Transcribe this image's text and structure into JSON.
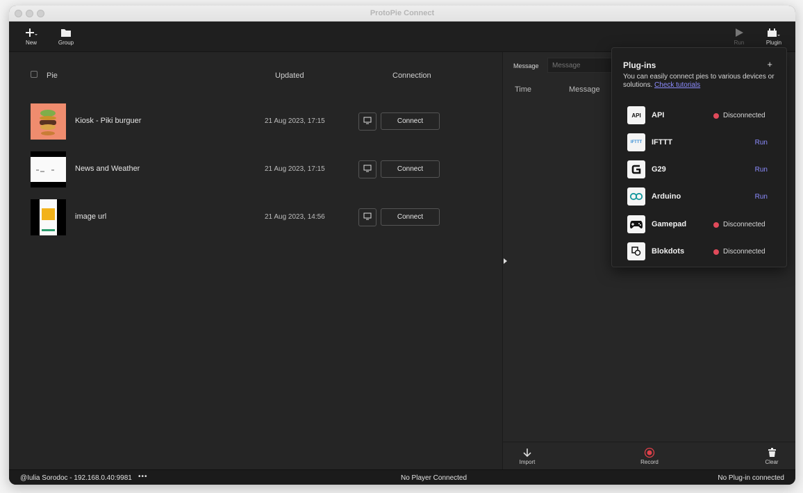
{
  "window": {
    "title": "ProtoPie Connect"
  },
  "toolbar": {
    "new_label": "New",
    "group_label": "Group",
    "run_label": "Run",
    "plugin_label": "Plugin"
  },
  "pie_list": {
    "headers": {
      "pie": "Pie",
      "updated": "Updated",
      "connection": "Connection"
    },
    "rows": [
      {
        "name": "Kiosk - Piki burguer",
        "updated": "21 Aug 2023, 17:15",
        "connect_label": "Connect"
      },
      {
        "name": "News and Weather",
        "updated": "21 Aug 2023, 17:15",
        "connect_label": "Connect"
      },
      {
        "name": "image url",
        "updated": "21 Aug 2023, 14:56",
        "connect_label": "Connect"
      }
    ]
  },
  "log": {
    "message_label": "Message",
    "message_placeholder": "Message",
    "columns": {
      "time": "Time",
      "message": "Message"
    },
    "bottom": {
      "import_label": "Import",
      "record_label": "Record",
      "clear_label": "Clear"
    }
  },
  "plugins_popup": {
    "title": "Plug-ins",
    "add_symbol": "+",
    "description": "You can easily connect pies to various devices or solutions.",
    "link_text": "Check tutorials",
    "items": [
      {
        "name": "API",
        "icon": "api-icon",
        "icon_text": "API",
        "status": "Disconnected"
      },
      {
        "name": "IFTTT",
        "icon": "ifttt-icon",
        "icon_text": "IFTTT",
        "action": "Run"
      },
      {
        "name": "G29",
        "icon": "g29-icon",
        "action": "Run"
      },
      {
        "name": "Arduino",
        "icon": "arduino-icon",
        "action": "Run"
      },
      {
        "name": "Gamepad",
        "icon": "gamepad-icon",
        "status": "Disconnected"
      },
      {
        "name": "Blokdots",
        "icon": "blokdots-icon",
        "status": "Disconnected"
      }
    ]
  },
  "status_bar": {
    "user": "@Iulia Sorodoc - 192.168.0.40:9981",
    "more": "•••",
    "player": "No Player Connected",
    "plugin": "No Plug-in connected"
  },
  "colors": {
    "accent_link": "#8c8cff",
    "status_disconnected": "#e04a5a",
    "record_red": "#e0404a"
  }
}
